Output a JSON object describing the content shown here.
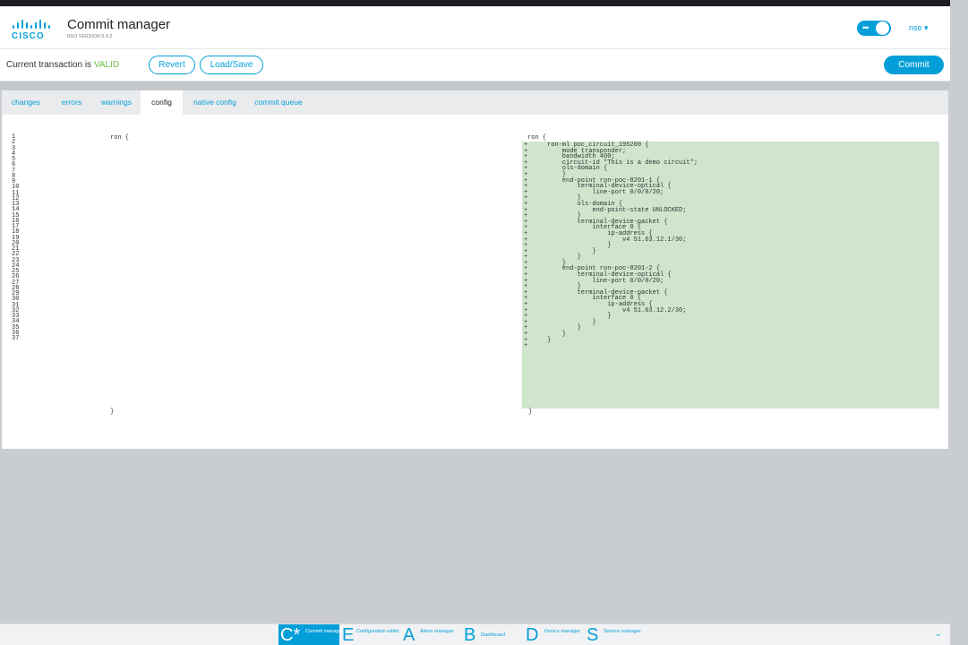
{
  "header": {
    "logo_text": "CISCO",
    "title": "Commit manager",
    "version": "NSO VERSION:5.4.2",
    "user_label": "nso ▾"
  },
  "transaction": {
    "status_prefix": "Current transaction is ",
    "status_value": "VALID",
    "revert_label": "Revert",
    "load_save_label": "Load/Save",
    "commit_label": "Commit"
  },
  "tabs": [
    {
      "label": "changes"
    },
    {
      "label": "errors"
    },
    {
      "label": "warnings"
    },
    {
      "label": "config"
    },
    {
      "label": "native config"
    },
    {
      "label": "commit queue"
    }
  ],
  "diff": {
    "line_numbers": "1\n2\n3\n4\n5\n6\n7\n8\n9\n10\n11\n12\n13\n14\n15\n16\n17\n18\n19\n20\n21\n22\n23\n24\n25\n26\n27\n28\n29\n30\n31\n32\n33\n34\n35\n36\n37",
    "left_open": "ron {",
    "left_close": "}",
    "right_open": "ron {",
    "right_close": "}",
    "added_markers": "+\n+\n+\n+\n+\n+\n+\n+\n+\n+\n+\n+\n+\n+\n+\n+\n+\n+\n+\n+\n+\n+\n+\n+\n+\n+\n+\n+\n+\n+\n+\n+\n+\n+\n+",
    "added_code": "ron-ml poc_circuit_195200 {\n    mode transponder;\n    bandwidth 400;\n    circuit-id \"This is a demo circuit\";\n    ols-domain {\n    }\n    end-point ron-poc-8201-1 {\n        terminal-device-optical {\n            line-port 0/0/0/20;\n        }\n        ols-domain {\n            end-point-state UNLOCKED;\n        }\n        terminal-device-packet {\n            interface 0 {\n                ip-address {\n                    v4 51.63.12.1/30;\n                }\n            }\n        }\n    }\n    end-point ron-poc-8201-2 {\n        terminal-device-optical {\n            line-port 0/0/0/20;\n        }\n        terminal-device-packet {\n            interface 0 {\n                ip-address {\n                    v4 51.63.12.2/30;\n                }\n            }\n        }\n    }\n}"
  },
  "bottom_nav": [
    {
      "letter": "C*",
      "label": "Commit manager",
      "active": true
    },
    {
      "letter": "E",
      "label": "Configuration editor"
    },
    {
      "letter": "A",
      "label": "Alarm manager"
    },
    {
      "letter": "B",
      "label": "Dashboard"
    },
    {
      "letter": "D",
      "label": "Device manager"
    },
    {
      "letter": "S",
      "label": "Service manager"
    }
  ],
  "figure_code": "521934",
  "colors": {
    "accent": "#049fd9",
    "valid": "#6cc04a",
    "added_bg": "#cfe6cd"
  }
}
